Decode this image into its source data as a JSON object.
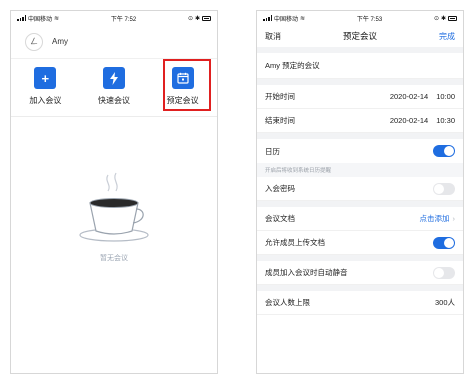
{
  "left": {
    "status": {
      "carrier": "中国移动",
      "time": "下午 7:52"
    },
    "user": {
      "avatar_glyph": "ㄥ",
      "name": "Amy"
    },
    "actions": [
      {
        "label": "加入会议",
        "icon": "plus-icon"
      },
      {
        "label": "快速会议",
        "icon": "lightning-icon"
      },
      {
        "label": "预定会议",
        "icon": "calendar-icon"
      }
    ],
    "empty_text": "暂无会议"
  },
  "right": {
    "status": {
      "carrier": "中国移动",
      "time": "下午 7:53"
    },
    "nav": {
      "cancel": "取消",
      "title": "预定会议",
      "done": "完成"
    },
    "meeting_title": "Amy 预定的会议",
    "start": {
      "label": "开始时间",
      "date": "2020-02-14",
      "time": "10:00"
    },
    "end": {
      "label": "结束时间",
      "date": "2020-02-14",
      "time": "10:30"
    },
    "calendar": {
      "label": "日历",
      "on": true,
      "hint": "开启后将收到系统日历提醒"
    },
    "password": {
      "label": "入会密码",
      "on": false
    },
    "docs": {
      "label": "会议文档",
      "action": "点击添加"
    },
    "allow_upload": {
      "label": "允许成员上传文档",
      "on": true
    },
    "auto_mute": {
      "label": "成员加入会议时自动静音",
      "on": false
    },
    "max_members": {
      "label": "会议人数上限",
      "value": "300人"
    }
  },
  "accent": "#1f6de0",
  "highlight_color": "#e02020"
}
